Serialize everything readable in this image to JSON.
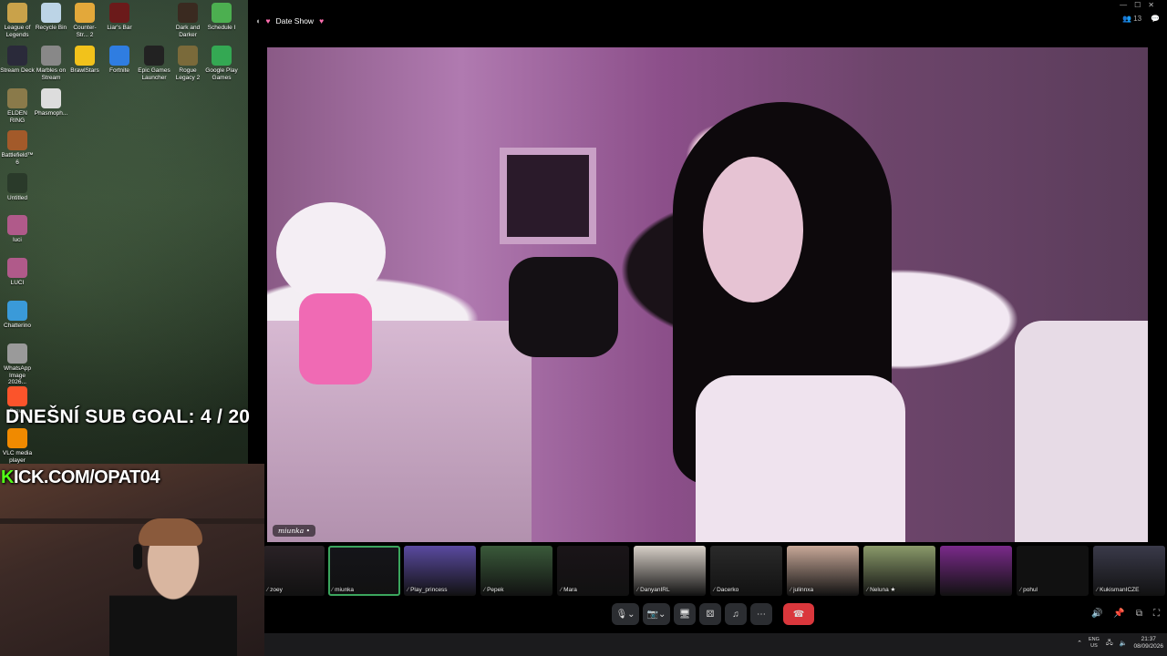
{
  "desktop": {
    "icons": [
      {
        "label": "League of Legends",
        "color": "#c9a24a"
      },
      {
        "label": "Recycle Bin",
        "color": "#bcd4e6"
      },
      {
        "label": "Counter-Str... 2",
        "color": "#e3a83a"
      },
      {
        "label": "Liar's Bar",
        "color": "#6b1a1a"
      },
      {
        "label": "Dark and Darker",
        "color": "#3a2a20"
      },
      {
        "label": "Schedule I",
        "color": "#4caf50"
      },
      {
        "label": "Stream Deck",
        "color": "#2a2a3a"
      },
      {
        "label": "Marbles on Stream",
        "color": "#888888"
      },
      {
        "label": "BrawlStars",
        "color": "#f2c21b"
      },
      {
        "label": "Fortnite",
        "color": "#2f7de1"
      },
      {
        "label": "Epic Games Launcher",
        "color": "#222222"
      },
      {
        "label": "Rogue Legacy 2",
        "color": "#7a6a3a"
      },
      {
        "label": "Google Play Games",
        "color": "#34a853"
      },
      {
        "label": "ELDEN RING",
        "color": "#8a7a4a"
      },
      {
        "label": "Phasmoph...",
        "color": "#dddddd"
      },
      {
        "label": "Battlefield™ 6",
        "color": "#a35a2a"
      },
      {
        "label": "Untitled",
        "color": "#2a3a2a"
      },
      {
        "label": "luci",
        "color": "#b05a8a"
      },
      {
        "label": "LUCI",
        "color": "#b05a8a"
      },
      {
        "label": "Chatterino",
        "color": "#3a9ad9"
      },
      {
        "label": "WhatsApp Image 2026...",
        "color": "#9a9a9a"
      },
      {
        "label": "Brave",
        "color": "#fb542b"
      },
      {
        "label": "VLC media player",
        "color": "#f08a00"
      }
    ]
  },
  "overlay": {
    "sub_goal": "DNEŠNÍ SUB GOAL: 4 / 20",
    "kick_k": "K",
    "kick_rest": "ICK.COM/OPAT04"
  },
  "call": {
    "title": "Date Show",
    "heart": "♥",
    "participant_count": "13",
    "main_name": "miunka",
    "main_mic": "•",
    "participants": [
      "zoey",
      "miunka",
      "Play_princess",
      "Pepek",
      "Mara",
      "DanyanIRL",
      "Dacerko",
      "julinnxa",
      "Neluna ★",
      "",
      "pohul",
      "KukismanICZE"
    ]
  },
  "window": {
    "controls": [
      "—",
      "☐",
      "✕"
    ]
  },
  "controls": {
    "mic": "🎙",
    "camera": "📷",
    "screen": "🖥",
    "activities": "⚄",
    "soundboard": "♫",
    "more": "⋯",
    "hangup": "☎",
    "chevron": "⌄"
  },
  "taskbar": {
    "lang_top": "ENG",
    "lang_bottom": "US",
    "time": "21:37",
    "date": "08/09/2026"
  }
}
